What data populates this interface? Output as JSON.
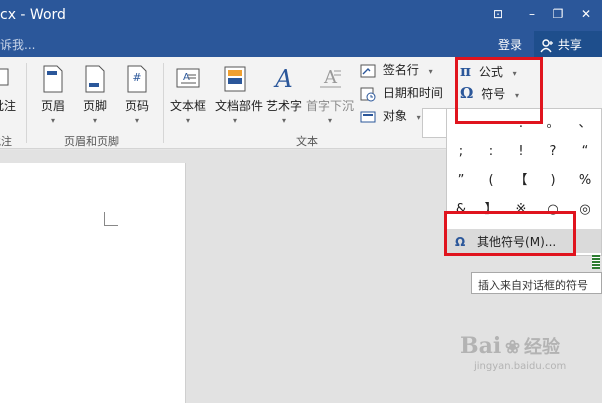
{
  "window": {
    "title": "cx - Word",
    "controls": {
      "ribbon_display": "⊡",
      "minimize": "–",
      "restore": "❐",
      "close": "✕"
    }
  },
  "tellbar": {
    "tell_text": "诉我...",
    "login": "登录",
    "share": "共享"
  },
  "ribbon": {
    "comment_group": {
      "partial_button": "批注",
      "label": "批注"
    },
    "header_footer": {
      "label": "页眉和页脚",
      "buttons": [
        {
          "label": "页眉"
        },
        {
          "label": "页脚"
        },
        {
          "label": "页码"
        }
      ]
    },
    "text": {
      "label": "文本",
      "buttons": [
        {
          "label": "文本框"
        },
        {
          "label": "文档部件"
        },
        {
          "label": "艺术字"
        },
        {
          "label": "首字下沉"
        }
      ],
      "small": {
        "signature": "签名行",
        "datetime": "日期和时间",
        "object": "对象"
      }
    },
    "symbols": {
      "equation": "公式",
      "symbol": "符号"
    }
  },
  "symbol_panel": {
    "rows": [
      [
        ".",
        "。",
        "、"
      ],
      [
        ";",
        ":",
        "!",
        "?",
        "“"
      ],
      [
        "”",
        "(",
        "【",
        ")",
        "%"
      ],
      [
        "&",
        "】",
        "※",
        "○",
        "◎"
      ]
    ],
    "more_label": "其他符号(M)...",
    "tooltip": "插入来自对话框的符号"
  },
  "watermark": {
    "brand": "Bai",
    "brand2": "经验",
    "url": "jingyan.baidu.com"
  },
  "colors": {
    "brand": "#2b579a",
    "highlight": "#e0141e",
    "ribbon_bg": "#f3f3f3"
  }
}
